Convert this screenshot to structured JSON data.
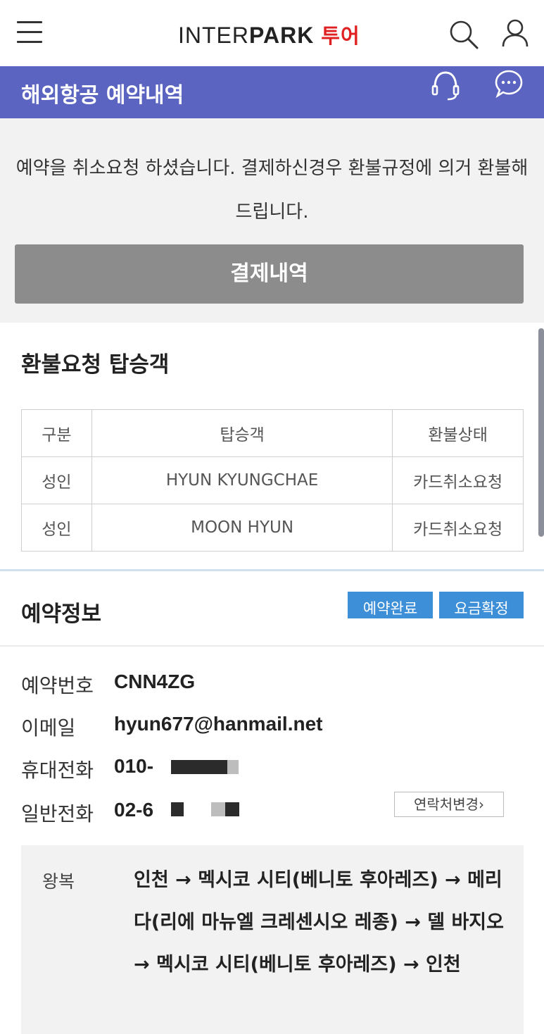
{
  "topbar": {
    "logo_thin": "INTER",
    "logo_bold": "PARK",
    "logo_tour": "투어"
  },
  "header": {
    "title": "해외항공 예약내역"
  },
  "notice": {
    "message": "예약을 취소요청 하셨습니다. 결제하신경우 환불규정에 의거 환불해 드립니다.",
    "payment_button": "결제내역"
  },
  "refund": {
    "title": "환불요청 탑승객",
    "columns": [
      "구분",
      "탑승객",
      "환불상태"
    ],
    "rows": [
      [
        "성인",
        "HYUN KYUNGCHAE",
        "카드취소요청"
      ],
      [
        "성인",
        "MOON HYUN",
        "카드취소요청"
      ]
    ]
  },
  "reservation": {
    "title": "예약정보",
    "badge_status": "예약완료",
    "badge_fare": "요금확정",
    "fields": [
      {
        "label": "예약번호",
        "value": "CNN4ZG"
      },
      {
        "label": "이메일",
        "value": "hyun677@hanmail.net"
      },
      {
        "label": "휴대전화",
        "value": "010-"
      },
      {
        "label": "일반전화",
        "value": "02-6"
      }
    ],
    "change_contact": "연락처변경",
    "route_label": "왕복",
    "route_text": "인천 → 멕시코 시티(베니토 후아레즈) → 메리다(리에 마뉴엘 크레센시오 레종) → 델 바지오 → 멕시코 시티(베니토 후아레즈) → 인천"
  },
  "colors": {
    "header_bg": "#5b64c0",
    "badge_bg": "#3d8fd8",
    "logo_accent": "#e02020",
    "payment_button_bg": "#8c8c8c"
  },
  "icons": [
    "menu-icon",
    "search-icon",
    "user-icon",
    "headset-icon",
    "chat-icon",
    "chevron-right-icon"
  ]
}
